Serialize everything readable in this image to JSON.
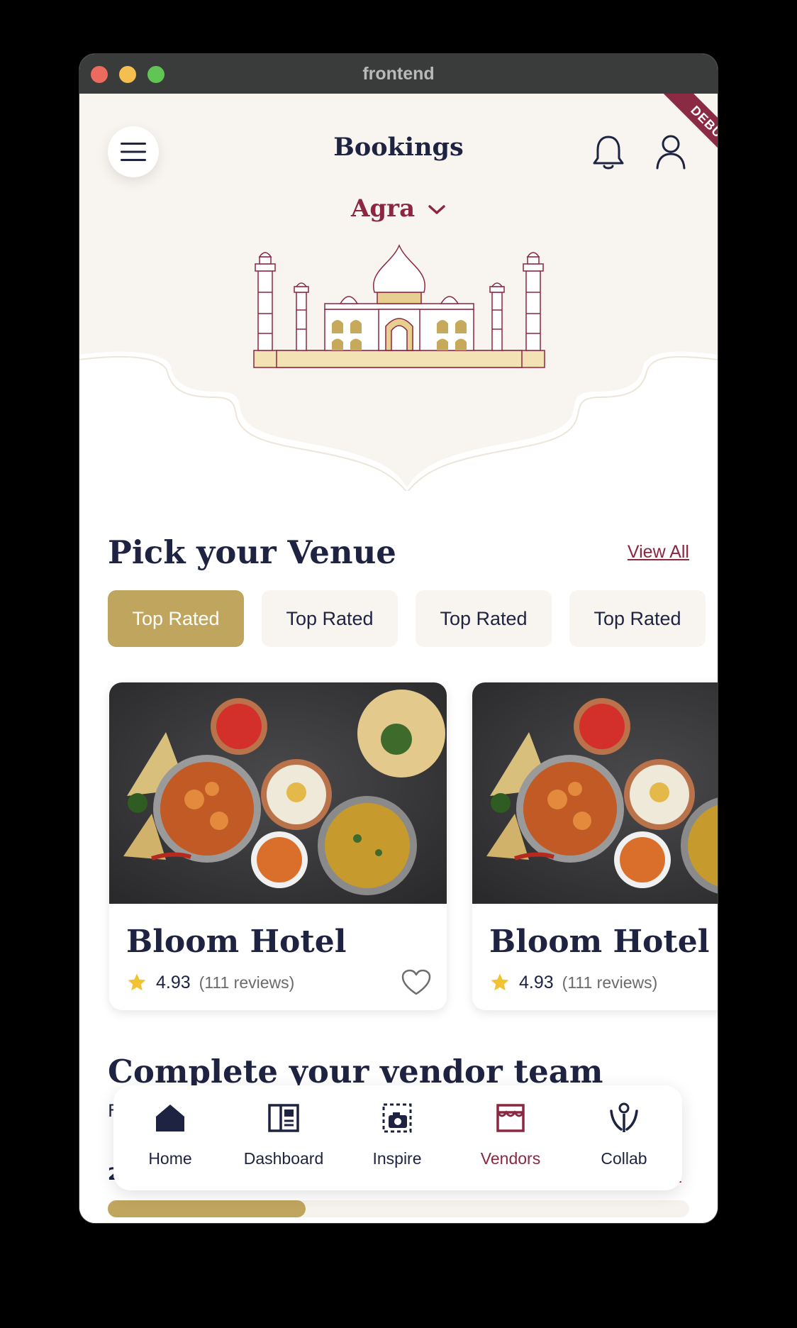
{
  "window": {
    "title": "frontend"
  },
  "header": {
    "title": "Bookings",
    "city": "Agra",
    "debug_label": "DEBUG"
  },
  "venues": {
    "title": "Pick your Venue",
    "view_all": "View All",
    "chips": [
      {
        "label": "Top Rated",
        "active": true
      },
      {
        "label": "Top Rated",
        "active": false
      },
      {
        "label": "Top Rated",
        "active": false
      },
      {
        "label": "Top Rated",
        "active": false
      }
    ],
    "cards": [
      {
        "name": "Bloom Hotel",
        "rating": "4.93",
        "reviews": "(111 reviews)"
      },
      {
        "name": "Bloom Hotel",
        "rating": "4.93",
        "reviews": "(111 reviews)"
      }
    ]
  },
  "vendors": {
    "title": "Complete your vendor team",
    "partial_subtitle": "F",
    "partial_count": "2",
    "partial_link": "l",
    "scroll_progress": 0.34
  },
  "bottom_nav": {
    "items": [
      {
        "label": "Home",
        "icon": "home-icon",
        "active": false
      },
      {
        "label": "Dashboard",
        "icon": "dashboard-icon",
        "active": false
      },
      {
        "label": "Inspire",
        "icon": "inspire-icon",
        "active": false
      },
      {
        "label": "Vendors",
        "icon": "store-icon",
        "active": true
      },
      {
        "label": "Collab",
        "icon": "collab-icon",
        "active": false
      }
    ]
  },
  "colors": {
    "brand": "#8b2741",
    "gold": "#bfa55e",
    "navy": "#1d2340",
    "cream": "#f8f5f0"
  }
}
